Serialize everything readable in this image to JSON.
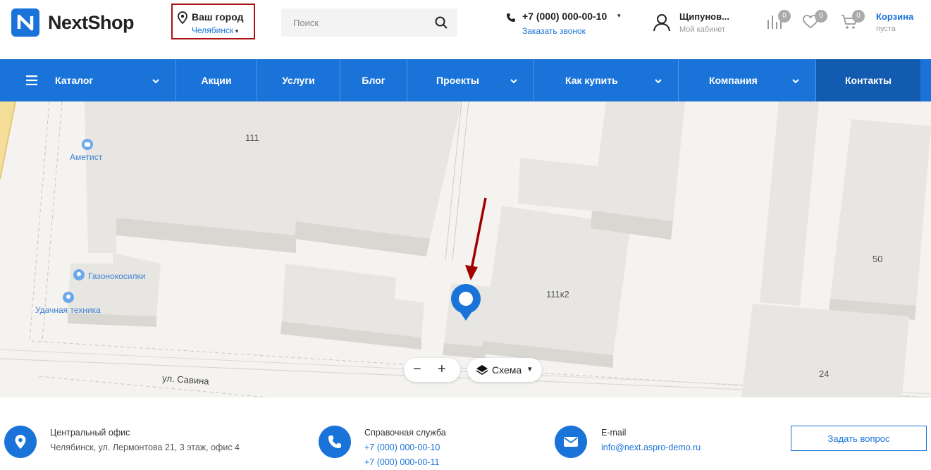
{
  "brand": {
    "name": "NextShop",
    "logo_letter": "N",
    "accent": "#1a73d9"
  },
  "city": {
    "title": "Ваш город",
    "value": "Челябинск"
  },
  "search": {
    "placeholder": "Поиск"
  },
  "contact": {
    "phone": "+7 (000) 000-00-10",
    "callback": "Заказать звонок"
  },
  "account": {
    "name": "Щипунов...",
    "label": "Мой кабинет"
  },
  "counters": {
    "compare": "0",
    "favorites": "0",
    "cart": "0"
  },
  "cart": {
    "title": "Корзина",
    "status": "пуста"
  },
  "nav": {
    "catalog": "Каталог",
    "sales": "Акции",
    "services": "Услуги",
    "blog": "Блог",
    "projects": "Проекты",
    "how_to_buy": "Как купить",
    "company": "Компания",
    "contacts": "Контакты"
  },
  "map": {
    "labels": {
      "b111": "111",
      "b111k2": "111к2",
      "b50": "50",
      "b24": "24",
      "street": "ул. Савина",
      "poi1": "Аметист",
      "poi2": "Газонокосилки",
      "poi3": "Удачная техника"
    },
    "layer_button": "Схема"
  },
  "footer": {
    "office_label": "Центральный офис",
    "office_address": "Челябинск, ул. Лермонтова 21, 3 этаж, офис 4",
    "help_label": "Справочная служба",
    "help_phone1": "+7 (000) 000-00-10",
    "help_phone2": "+7 (000) 000-00-11",
    "email_label": "E-mail",
    "email_value": "info@next.aspro-demo.ru",
    "ask_button": "Задать вопрос"
  }
}
